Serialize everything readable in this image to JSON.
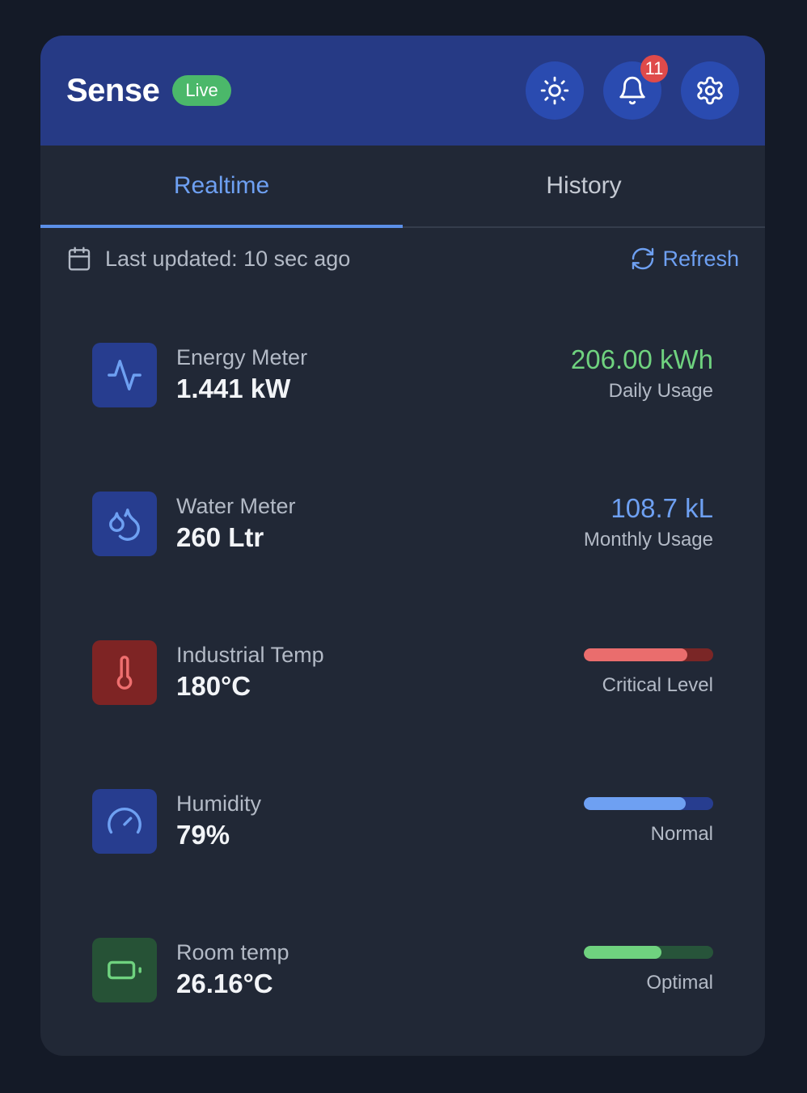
{
  "header": {
    "brand": "Sense",
    "live_label": "Live",
    "notification_count": "11"
  },
  "tabs": [
    {
      "label": "Realtime",
      "active": true
    },
    {
      "label": "History",
      "active": false
    }
  ],
  "status": {
    "last_updated": "Last updated: 10 sec ago",
    "refresh_label": "Refresh"
  },
  "sensors": [
    {
      "name": "Energy Meter",
      "value": "1.441 kW",
      "usage_value": "206.00 kWh",
      "usage_label": "Daily Usage",
      "usage_color": "#6fd27f",
      "icon": "activity-icon",
      "icon_bg": "#273d8f",
      "icon_color": "#6ea0f2"
    },
    {
      "name": "Water Meter",
      "value": "260 Ltr",
      "usage_value": "108.7 kL",
      "usage_label": "Monthly Usage",
      "usage_color": "#6ea0f2",
      "icon": "droplets-icon",
      "icon_bg": "#273d8f",
      "icon_color": "#6ea0f2"
    },
    {
      "name": "Industrial Temp",
      "value": "180°C",
      "level_label": "Critical Level",
      "level_fraction": 0.8,
      "level_color": "#ea6d6d",
      "level_track": "#7a2626",
      "icon": "thermometer-icon",
      "icon_bg": "#7e2424",
      "icon_color": "#ef6f6f"
    },
    {
      "name": "Humidity",
      "value": "79%",
      "level_label": "Normal",
      "level_fraction": 0.79,
      "level_color": "#6ea0f2",
      "level_track": "#273d8f",
      "icon": "gauge-icon",
      "icon_bg": "#273d8f",
      "icon_color": "#6ea0f2"
    },
    {
      "name": "Room temp",
      "value": "26.16°C",
      "level_label": "Optimal",
      "level_fraction": 0.6,
      "level_color": "#6fd27f",
      "level_track": "#27543a",
      "icon": "battery-icon",
      "icon_bg": "#265236",
      "icon_color": "#6fd27f"
    }
  ]
}
